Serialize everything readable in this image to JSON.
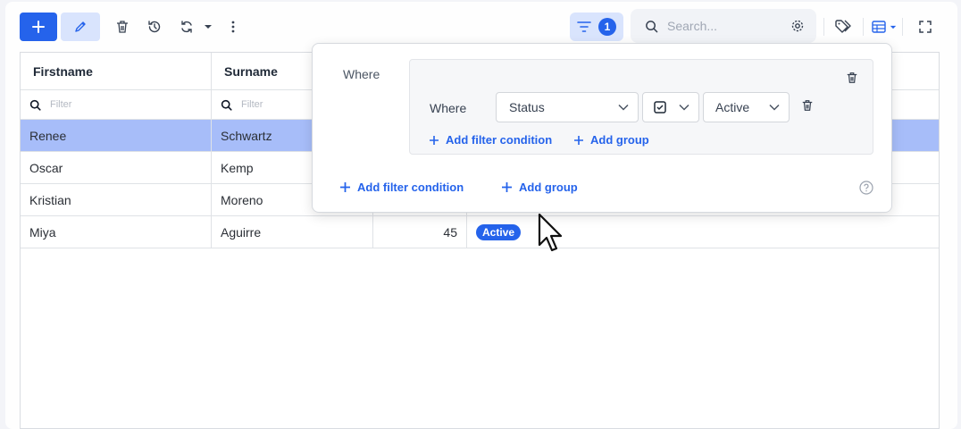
{
  "toolbar": {
    "add_icon": "plus-icon",
    "edit_icon": "pencil-icon",
    "delete_icon": "trash-icon",
    "history_icon": "history-icon",
    "refresh_icon": "refresh-icon",
    "more_icon": "more-vertical-icon",
    "filter_count": "1",
    "search_placeholder": "Search...",
    "accent": "#2563eb"
  },
  "table": {
    "columns": [
      "Firstname",
      "Surname",
      "",
      ""
    ],
    "filter_placeholder": "Filter",
    "rows": [
      {
        "firstname": "Renee",
        "surname": "Schwartz",
        "age": "",
        "status": "",
        "selected": true
      },
      {
        "firstname": "Oscar",
        "surname": "Kemp",
        "age": "",
        "status": ""
      },
      {
        "firstname": "Kristian",
        "surname": "Moreno",
        "age": "",
        "status": ""
      },
      {
        "firstname": "Miya",
        "surname": "Aguirre",
        "age": "45",
        "status": "Active"
      }
    ]
  },
  "filter_popover": {
    "where_outer": "Where",
    "where_inner": "Where",
    "field": "Status",
    "value": "Active",
    "inner_add_condition": "Add filter condition",
    "inner_add_group": "Add group",
    "outer_add_condition": "Add filter condition",
    "outer_add_group": "Add group"
  }
}
